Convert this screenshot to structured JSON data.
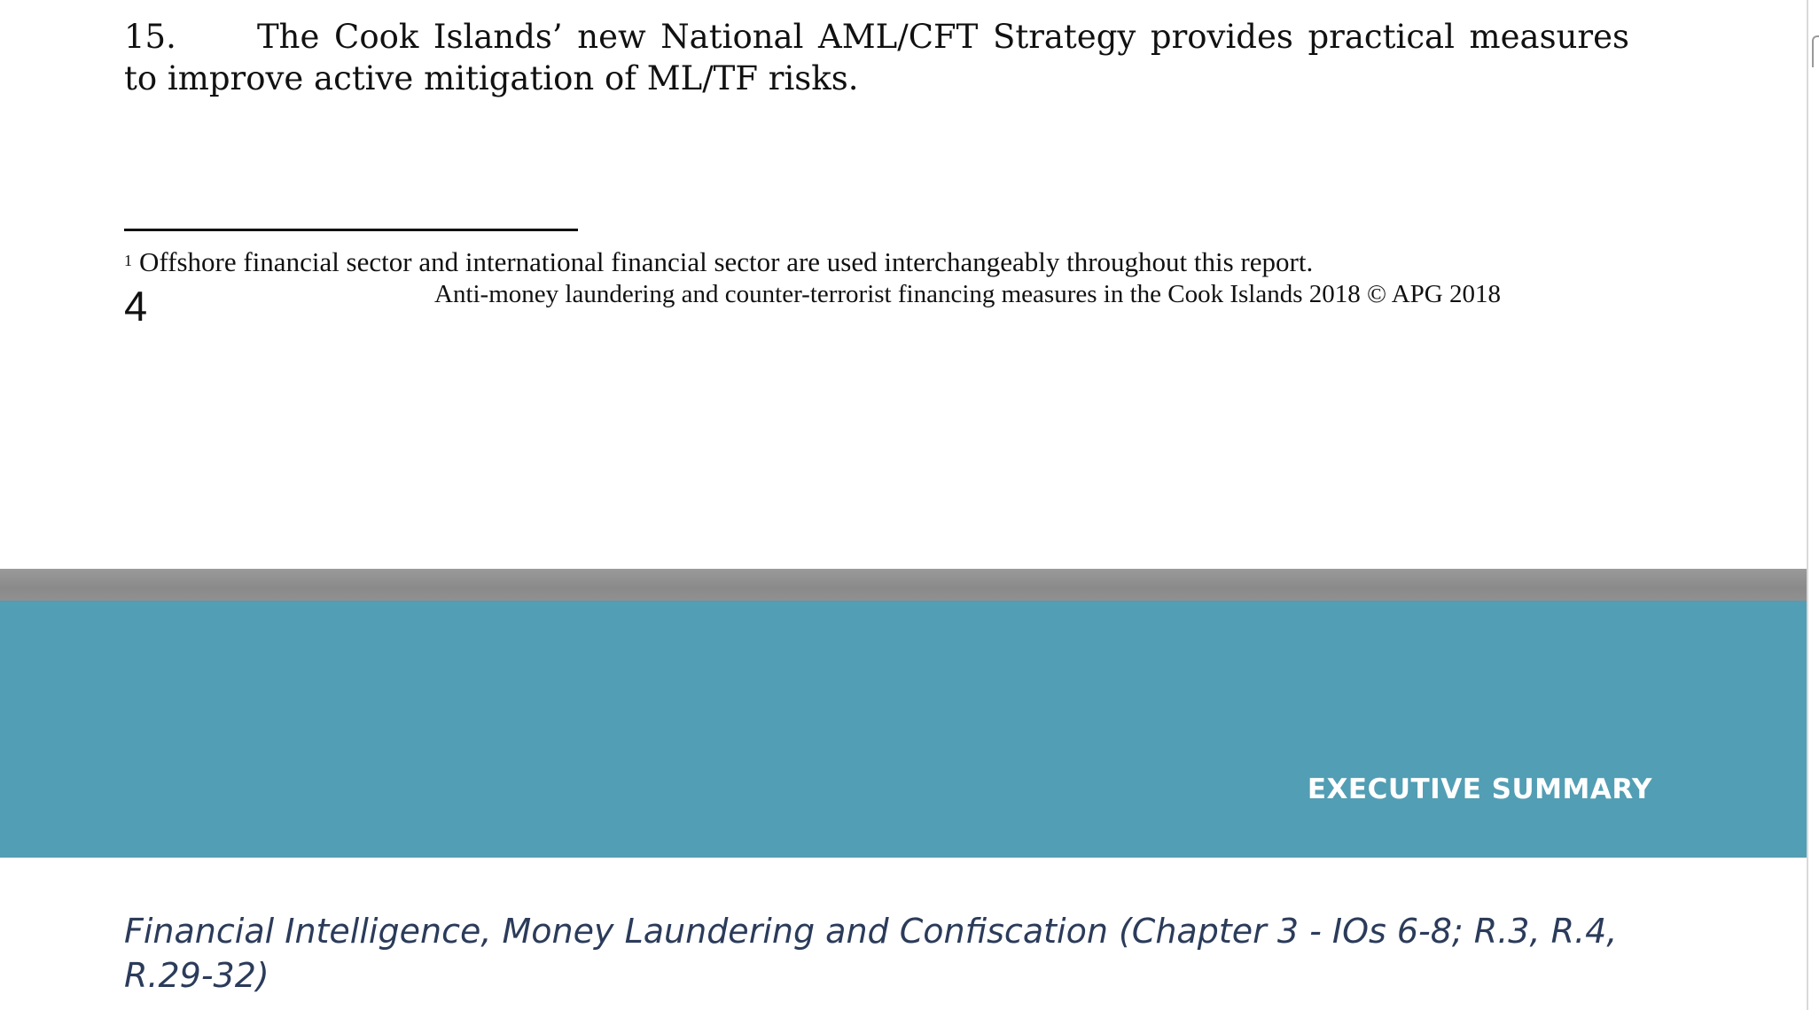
{
  "page_top": {
    "paragraph": {
      "number": "15.",
      "text": "The Cook Islands’ new National AML/CFT Strategy provides practical measures to improve active mitigation of ML/TF risks."
    },
    "footnote": {
      "marker": "1",
      "text": "Offshore financial sector and international financial sector are used interchangeably throughout this report."
    },
    "page_number": "4",
    "footer": "Anti-money laundering and counter-terrorist financing measures in the Cook Islands 2018 © APG 2018"
  },
  "page_bottom": {
    "banner": {
      "title": "EXECUTIVE SUMMARY",
      "color": "#529eb4"
    },
    "section_heading": "Financial Intelligence, Money Laundering and Confiscation (Chapter 3 - IOs 6-8; R.3, R.4, R.29-32)",
    "heading_color": "#2b3b5a"
  }
}
